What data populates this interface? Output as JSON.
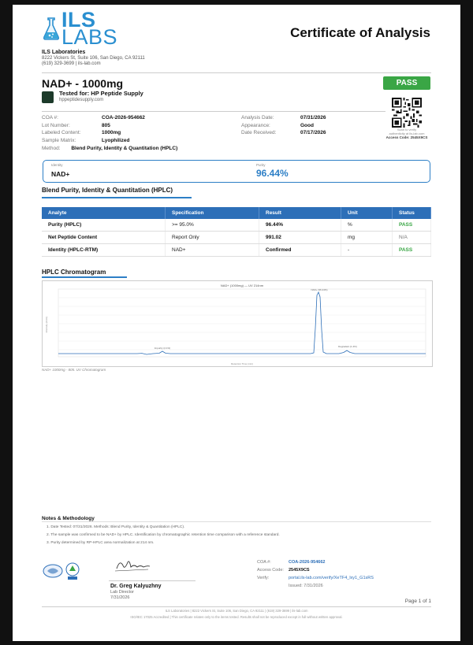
{
  "header": {
    "logo_line1": "ILS",
    "logo_line2": "LABS",
    "doc_title": "Certificate of Analysis",
    "company_name": "ILS Laboratories",
    "company_address": "8222 Vickers St, Suite 106, San Diego, CA 92111",
    "company_contact": "(619) 329-3699  |  ils-lab.com"
  },
  "product": {
    "name": "NAD+ - 1000mg",
    "tested_for": "Tested for: HP Peptide Supply",
    "client_site": "hppeptidesupply.com"
  },
  "badge": {
    "result": "PASS"
  },
  "qr": {
    "caption_line1": "Scan to verify",
    "caption_line2": "authenticity at ils-lab.com",
    "access_code_line": "Access Code: 2545X9CS"
  },
  "meta_left": [
    {
      "label": "COA #:",
      "value": "COA-2026-954662"
    },
    {
      "label": "Lot Number:",
      "value": "805"
    },
    {
      "label": "Labeled Content:",
      "value": "1000mg"
    },
    {
      "label": "Sample Matrix:",
      "value": "Lyophilized"
    }
  ],
  "meta_right": [
    {
      "label": "Analysis Date:",
      "value": "07/31/2026"
    },
    {
      "label": "Appearance:",
      "value": "Good"
    },
    {
      "label": "Date Received:",
      "value": "07/17/2026"
    }
  ],
  "method": {
    "label": "Method:",
    "value": "Blend Purity, Identity & Quantitation (HPLC)"
  },
  "summary": {
    "identity_label": "Identity",
    "identity_value": "NAD+",
    "purity_label": "Purity",
    "purity_value": "96.44%"
  },
  "results": {
    "section_title": "Blend Purity, Identity & Quantitation (HPLC)",
    "headers": [
      "Analyte",
      "Specification",
      "Result",
      "Unit",
      "Status"
    ],
    "rows": [
      {
        "analyte": "Purity (HPLC)",
        "spec": ">= 95.0%",
        "result": "96.44%",
        "unit": "%",
        "status": "PASS"
      },
      {
        "analyte": "Net Peptide Content",
        "spec": "Report Only",
        "result": "991.02",
        "unit": "mg",
        "status": "N/A"
      },
      {
        "analyte": "Identity (HPLC-RTM)",
        "spec": "NAD+",
        "result": "Confirmed",
        "unit": "-",
        "status": "PASS"
      }
    ]
  },
  "chromatogram": {
    "section_title": "HPLC Chromatogram",
    "plot_title": "NAD+ (1000mg) — UV 214nm",
    "caption": "NAD+ 1000mg - 805. UV Chromatogram",
    "x_axis_label": "Retention Time (min)",
    "y_axis_label": "Intensity (mAU)",
    "peak_main_label": "NAD+ (96.44%)",
    "peak_minor_label": "Impurity (2.1%)",
    "peak_late_label": "Degradant (1.4%)",
    "line_color": "#2d6fb8"
  },
  "notes": {
    "title": "Notes & Methodology",
    "items": [
      "1. Date Tested: 07/31/2026. Methods: Blend Purity, Identity & Quantitation (HPLC).",
      "2. The sample was confirmed to be NAD+ by HPLC. Identification by chromatographic retention time comparison with a reference standard.",
      "3. Purity determined by RP-HPLC area normalization at 214 nm."
    ]
  },
  "signature": {
    "name": "Dr. Greg Kalyuzhny",
    "role": "Lab Director",
    "date": "7/31/2026"
  },
  "verify": {
    "coa_label": "COA #:",
    "coa_value": "COA-2026-954662",
    "access_label": "Access Code:",
    "access_value": "2545X9CS",
    "verify_label": "Verify:",
    "verify_value": "portal.ils-lab.com/verify/XeTF4_lxy1_G1sRS",
    "issued": "Issued: 7/31/2026"
  },
  "page_number": "Page 1 of 1",
  "footer": {
    "line1": "ILS Laboratories  |  8222 Vickers St, Suite 106, San Diego, CA 92111  |  (619) 329-3699  |  ils-lab.com",
    "line2": "ISO/IEC 17025 Accredited  |  This certificate relates only to the items tested. Results shall not be reproduced except in full without written approval."
  }
}
